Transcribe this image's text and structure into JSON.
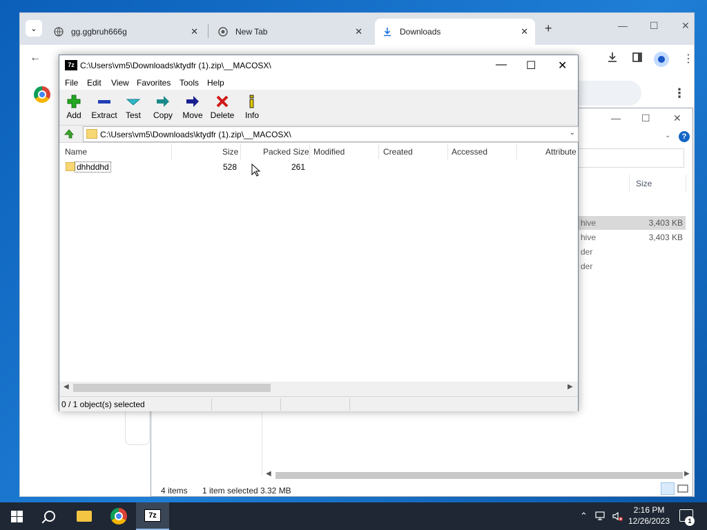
{
  "chrome": {
    "tabs": [
      {
        "title": "gg.ggbruh666g",
        "icon": "globe-icon"
      },
      {
        "title": "New Tab",
        "icon": "chrome-icon"
      },
      {
        "title": "Downloads",
        "icon": "download-icon"
      }
    ],
    "active_tab": 2
  },
  "explorer": {
    "column_size": "Size",
    "rows": [
      {
        "kind": "hive",
        "size": "3,403 KB",
        "selected": true
      },
      {
        "kind": "hive",
        "size": "3,403 KB",
        "selected": false
      },
      {
        "kind": "der",
        "size": "",
        "selected": false
      },
      {
        "kind": "der",
        "size": "",
        "selected": false
      }
    ],
    "status_items": "4 items",
    "status_selected": "1 item selected",
    "status_size": "3.32 MB"
  },
  "sevenzip": {
    "title": "C:\\Users\\vm5\\Downloads\\ktydfr (1).zip\\__MACOSX\\",
    "logo": "7z",
    "menu": [
      "File",
      "Edit",
      "View",
      "Favorites",
      "Tools",
      "Help"
    ],
    "toolbar": [
      {
        "label": "Add",
        "icon": "add-icon",
        "color": "#22a822"
      },
      {
        "label": "Extract",
        "icon": "extract-icon",
        "color": "#1f3fb5"
      },
      {
        "label": "Test",
        "icon": "test-icon",
        "color": "#2fb9c9"
      },
      {
        "label": "Copy",
        "icon": "copy-icon",
        "color": "#1c8a8a"
      },
      {
        "label": "Move",
        "icon": "move-icon",
        "color": "#1a1f8f"
      },
      {
        "label": "Delete",
        "icon": "delete-icon",
        "color": "#d01818"
      },
      {
        "label": "Info",
        "icon": "info-icon",
        "color": "#c8b000"
      }
    ],
    "address": "C:\\Users\\vm5\\Downloads\\ktydfr (1).zip\\__MACOSX\\",
    "columns": [
      "Name",
      "Size",
      "Packed Size",
      "Modified",
      "Created",
      "Accessed",
      "Attribute"
    ],
    "files": [
      {
        "name": "dhhddhd",
        "size": "528",
        "packed": "261"
      }
    ],
    "status": "0 / 1 object(s) selected"
  },
  "taskbar": {
    "time": "2:16 PM",
    "date": "12/26/2023",
    "notifications": "1"
  }
}
